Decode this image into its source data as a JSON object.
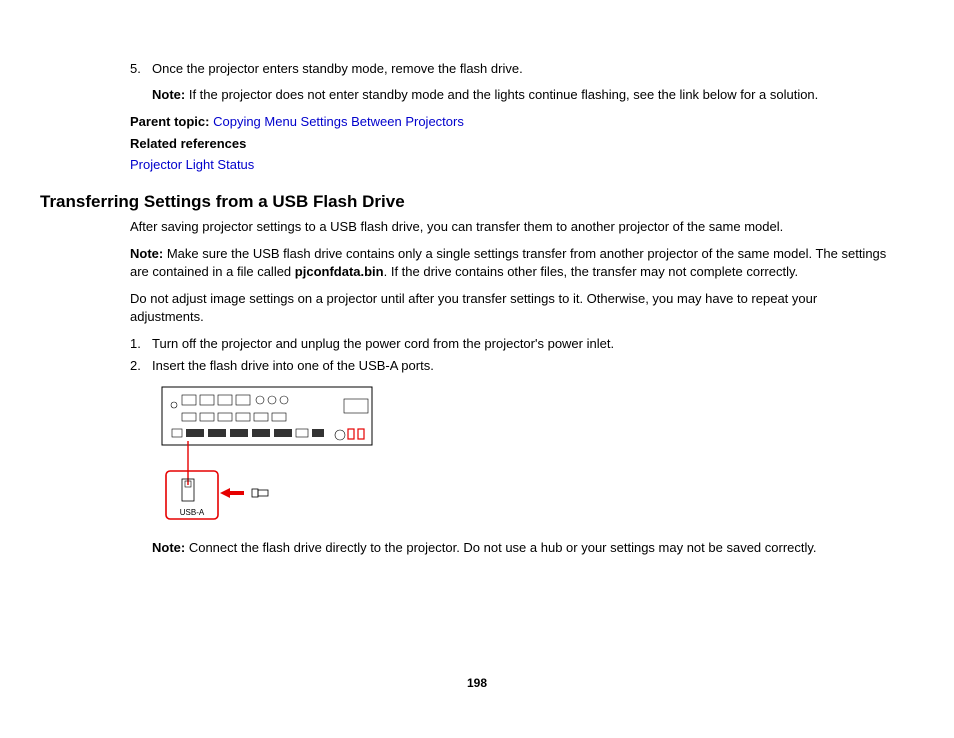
{
  "step5_num": "5.",
  "step5_text": "Once the projector enters standby mode, remove the flash drive.",
  "note1_label": "Note:",
  "note1_text": " If the projector does not enter standby mode and the lights continue flashing, see the link below for a solution.",
  "parent_topic_label": "Parent topic:",
  "parent_topic_link": "Copying Menu Settings Between Projectors",
  "related_refs_label": "Related references",
  "related_refs_link": "Projector Light Status",
  "heading": "Transferring Settings from a USB Flash Drive",
  "para1": "After saving projector settings to a USB flash drive, you can transfer them to another projector of the same model.",
  "note2_label": "Note:",
  "note2_a": " Make sure the USB flash drive contains only a single settings transfer from another projector of the same model. The settings are contained in a file called ",
  "note2_bold": "pjconfdata.bin",
  "note2_b": ". If the drive contains other files, the transfer may not complete correctly.",
  "para2": "Do not adjust image settings on a projector until after you transfer settings to it. Otherwise, you may have to repeat your adjustments.",
  "step1_num": "1.",
  "step1_text": "Turn off the projector and unplug the power cord from the projector's power inlet.",
  "step2_num": "2.",
  "step2_text": "Insert the flash drive into one of the USB-A ports.",
  "usb_label": "USB-A",
  "note3_label": "Note:",
  "note3_text": " Connect the flash drive directly to the projector. Do not use a hub or your settings may not be saved correctly.",
  "page_number": "198"
}
